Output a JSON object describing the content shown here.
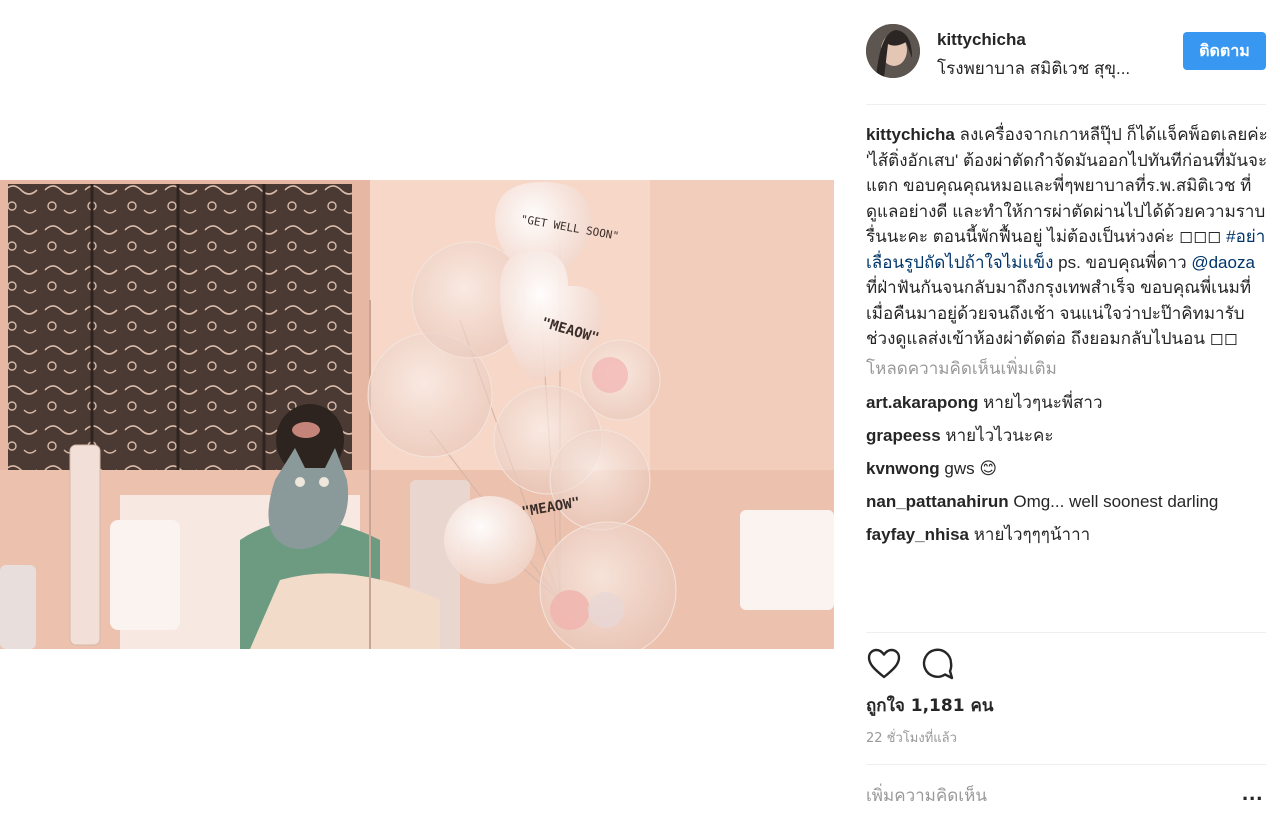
{
  "post": {
    "username": "kittychicha",
    "location": "โรงพยาบาล สมิติเวช สุขุ...",
    "follow_label": "ติดตาม",
    "photo_texts": {
      "balloon_1": "\"GET WELL SOON\"",
      "balloon_2": "\"MEAOW\"",
      "balloon_3": "\"MEAOW\""
    },
    "caption": {
      "username": "kittychicha",
      "text": " ลงเครื่องจากเกาหลีปุ๊ป ก็ได้แจ็คพ็อตเลยค่ะ 'ไส้ติ่งอักเสบ' ต้องผ่าตัดกำจัดมันออกไปทันทีก่อนที่มันจะแตก ขอบคุณคุณหมอและพี่ๆพยาบาลที่ร.พ.สมิติเวช ที่ดูแลอย่างดี และทำให้การผ่าตัดผ่านไปได้ด้วยความราบรื่นนะคะ ตอนนี้พักฟื้นอยู่ ไม่ต้องเป็นห่วงค่ะ ◻◻◻ ",
      "hashtag": "#อย่าเลื่อนรูปถัดไปถ้าใจไม่แข็ง",
      "text2": " ps. ขอบคุณพี่ดาว ",
      "mention": "@daoza",
      "text3": " ที่ฝ่าฟันกันจนกลับมาถึงกรุงเทพสำเร็จ ขอบคุณพี่เนมที่เมื่อคืนมาอยู่ด้วยจนถึงเช้า จนแน่ใจว่าปะป๊าคิทมารับช่วงดูแลส่งเข้าห้องผ่าตัดต่อ ถึงยอมกลับไปนอน ◻◻"
    },
    "load_more": "โหลดความคิดเห็นเพิ่มเติม",
    "comments": [
      {
        "user": "art.akarapong",
        "text": " หายไวๆนะพี่สาว"
      },
      {
        "user": "grapeess",
        "text": " หายไวไวนะคะ"
      },
      {
        "user": "kvnwong",
        "text": " gws 😊"
      },
      {
        "user": "nan_pattanahirun",
        "text": " Omg... well soonest darling"
      },
      {
        "user": "fayfay_nhisa",
        "text": " หายไวๆๆๆน้าาา"
      }
    ],
    "actions": {
      "like_icon": "heart-icon",
      "comment_icon": "comment-bubble-icon"
    },
    "likes": "ถูกใจ 1,181 คน",
    "timestamp": "22 ชั่วโมงที่แล้ว",
    "add_comment_placeholder": "เพิ่มความคิดเห็น",
    "more_label": "..."
  }
}
